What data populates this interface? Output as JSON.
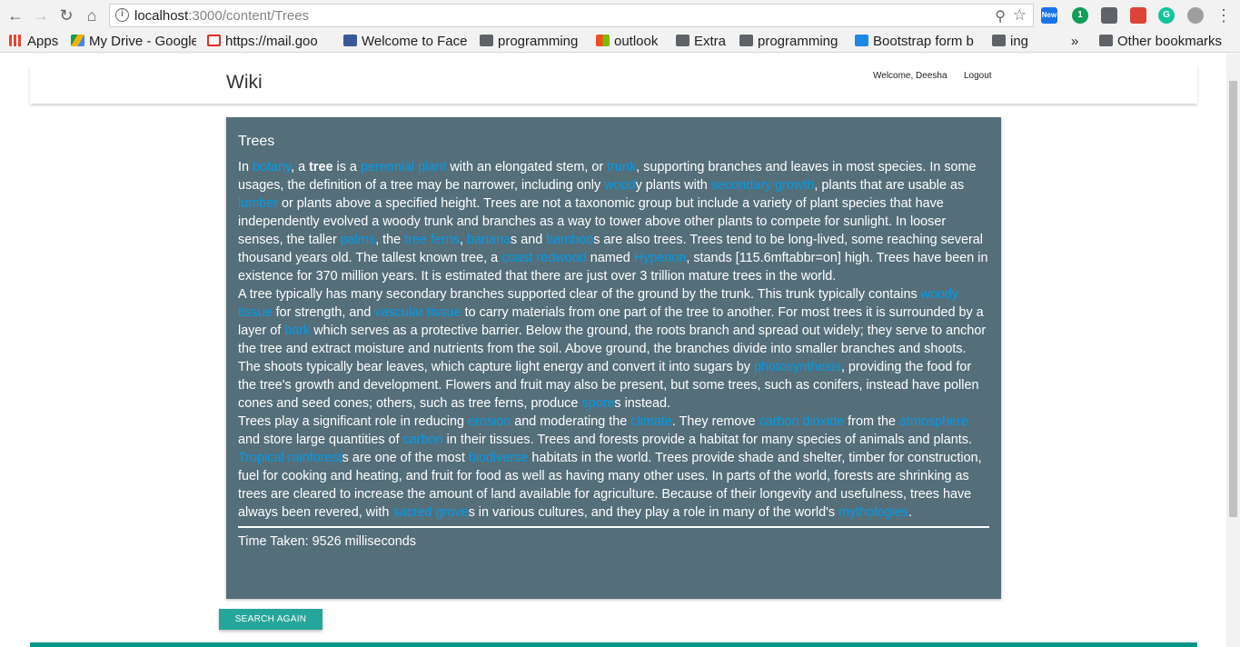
{
  "browser": {
    "url_host": "localhost",
    "url_path": ":3000/content/Trees",
    "ext_new_badge": "New",
    "ext_count_badge": "1",
    "bookmarks": [
      {
        "label": "Apps",
        "icon": "apps-grid-icon"
      },
      {
        "label": "My Drive - Google",
        "icon": "google-drive-icon"
      },
      {
        "label": "https://mail.goo",
        "icon": "gmail-icon"
      },
      {
        "label": "Welcome to Face",
        "icon": "facebook-icon"
      },
      {
        "label": "programming",
        "icon": "folder-icon"
      },
      {
        "label": "outlook",
        "icon": "windows-icon"
      },
      {
        "label": "Extra",
        "icon": "folder-icon"
      },
      {
        "label": "programming",
        "icon": "folder-icon"
      },
      {
        "label": "Bootstrap form b",
        "icon": "bootstrap-icon"
      },
      {
        "label": "ing",
        "icon": "folder-icon"
      }
    ],
    "overflow": "»",
    "other_bookmarks": "Other bookmarks"
  },
  "navbar": {
    "brand": "Wiki",
    "welcome": "Welcome, Deesha",
    "logout": "Logout"
  },
  "card": {
    "title": "Trees",
    "time_taken": "Time Taken: 9526 milliseconds",
    "link_color": "#039be5",
    "background": "#546e7a"
  },
  "article": {
    "p1": [
      {
        "t": "In "
      },
      {
        "t": "botany",
        "link": true
      },
      {
        "t": ", a "
      },
      {
        "t": "tree",
        "bold": true
      },
      {
        "t": " is a "
      },
      {
        "t": "perennial plant",
        "link": true
      },
      {
        "t": " with an elongated stem, or "
      },
      {
        "t": "trunk",
        "link": true
      },
      {
        "t": ", supporting branches and leaves in most species. In some usages, the definition of a tree may be narrower, including only "
      },
      {
        "t": "wood",
        "link": true
      },
      {
        "t": "y plants with "
      },
      {
        "t": "secondary growth",
        "link": true
      },
      {
        "t": ", plants that are usable as "
      },
      {
        "t": "lumber",
        "link": true
      },
      {
        "t": " or plants above a specified height. Trees are not a taxonomic group but include a variety of plant species that have independently evolved a woody trunk and branches as a way to tower above other plants to compete for sunlight. In looser senses, the taller "
      },
      {
        "t": "palms",
        "link": true
      },
      {
        "t": ", the "
      },
      {
        "t": "tree ferns",
        "link": true
      },
      {
        "t": ", "
      },
      {
        "t": "banana",
        "link": true
      },
      {
        "t": "s and "
      },
      {
        "t": "bamboo",
        "link": true
      },
      {
        "t": "s are also trees. Trees tend to be long-lived, some reaching several thousand years old. The tallest known tree, a "
      },
      {
        "t": "coast redwood",
        "link": true
      },
      {
        "t": " named "
      },
      {
        "t": "Hyperion",
        "link": true
      },
      {
        "t": ", stands [115.6mftabbr=on] high. Trees have been in existence for 370 million years. It is estimated that there are just over 3 trillion mature trees in the world."
      }
    ],
    "p2": [
      {
        "t": "A tree typically has many secondary branches supported clear of the ground by the trunk. This trunk typically contains "
      },
      {
        "t": "woody tissue",
        "link": true
      },
      {
        "t": " for strength, and "
      },
      {
        "t": "vascular tissue",
        "link": true
      },
      {
        "t": " to carry materials from one part of the tree to another. For most trees it is surrounded by a layer of "
      },
      {
        "t": "bark",
        "link": true
      },
      {
        "t": " which serves as a protective barrier. Below the ground, the roots branch and spread out widely; they serve to anchor the tree and extract moisture and nutrients from the soil. Above ground, the branches divide into smaller branches and shoots. The shoots typically bear leaves, which capture light energy and convert it into sugars by "
      },
      {
        "t": "photosynthesis",
        "link": true
      },
      {
        "t": ", providing the food for the tree's growth and development. Flowers and fruit may also be present, but some trees, such as conifers, instead have pollen cones and seed cones; others, such as tree ferns, produce "
      },
      {
        "t": "spore",
        "link": true
      },
      {
        "t": "s instead."
      }
    ],
    "p3": [
      {
        "t": "Trees play a significant role in reducing "
      },
      {
        "t": "erosion",
        "link": true
      },
      {
        "t": " and moderating the "
      },
      {
        "t": "climate",
        "link": true
      },
      {
        "t": ". They remove "
      },
      {
        "t": "carbon dioxide",
        "link": true
      },
      {
        "t": " from the "
      },
      {
        "t": "atmosphere",
        "link": true
      },
      {
        "t": " and store large quantities of "
      },
      {
        "t": "carbon",
        "link": true
      },
      {
        "t": " in their tissues. Trees and forests provide a habitat for many species of animals and plants. "
      },
      {
        "t": "Tropical rainforest",
        "link": true
      },
      {
        "t": "s are one of the most "
      },
      {
        "t": "biodiverse",
        "link": true
      },
      {
        "t": " habitats in the world. Trees provide shade and shelter, timber for construction, fuel for cooking and heating, and fruit for food as well as having many other uses. In parts of the world, forests are shrinking as trees are cleared to increase the amount of land available for agriculture. Because of their longevity and usefulness, trees have always been revered, with "
      },
      {
        "t": "sacred grove",
        "link": true
      },
      {
        "t": "s in various cultures, and they play a role in many of the world's "
      },
      {
        "t": "mythologies",
        "link": true
      },
      {
        "t": "."
      }
    ]
  },
  "actions": {
    "search_again": "SEARCH AGAIN"
  }
}
